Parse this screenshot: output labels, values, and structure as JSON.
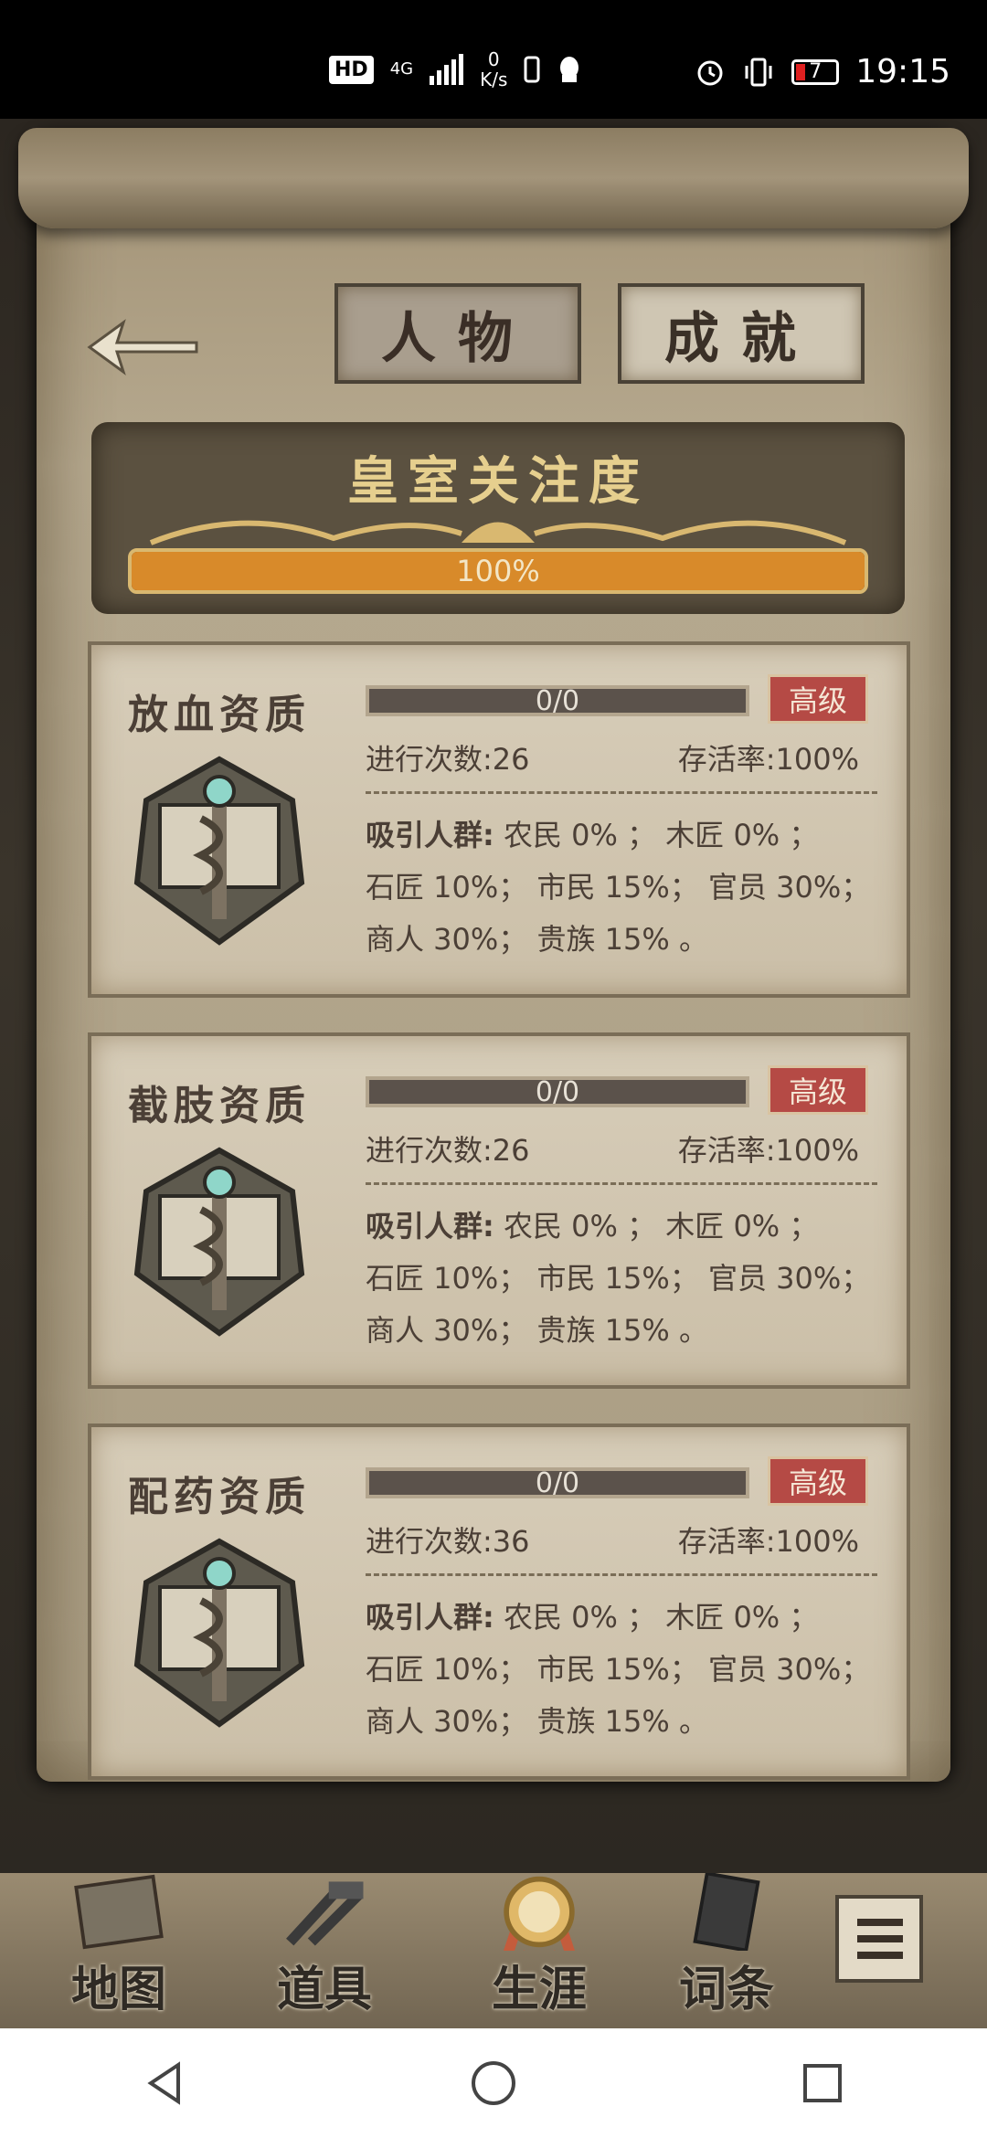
{
  "status_bar": {
    "hd": "HD",
    "net": "4G",
    "speed_value": "0",
    "speed_unit": "K/s",
    "battery": "7",
    "time": "19:15"
  },
  "header": {
    "tabs": [
      {
        "label": "人物",
        "active": true
      },
      {
        "label": "成就",
        "active": false
      }
    ]
  },
  "royal_attention": {
    "title": "皇室关注度",
    "progress_percent": 100,
    "progress_text": "100%"
  },
  "cards": [
    {
      "title": "放血资质",
      "bar_text": "0/0",
      "badge": "高级",
      "count_label": "进行次数:26",
      "survival_label": "存活率:100%",
      "attract_label": "吸引人群:",
      "line1": " 农民 0% ； 木匠 0% ；",
      "line2": "石匠 10%； 市民 15%； 官员 30%；",
      "line3": "商人 30%； 贵族 15% 。"
    },
    {
      "title": "截肢资质",
      "bar_text": "0/0",
      "badge": "高级",
      "count_label": "进行次数:26",
      "survival_label": "存活率:100%",
      "attract_label": "吸引人群:",
      "line1": " 农民 0% ； 木匠 0% ；",
      "line2": "石匠 10%； 市民 15%； 官员 30%；",
      "line3": "商人 30%； 贵族 15% 。"
    },
    {
      "title": "配药资质",
      "bar_text": "0/0",
      "badge": "高级",
      "count_label": "进行次数:36",
      "survival_label": "存活率:100%",
      "attract_label": "吸引人群:",
      "line1": " 农民 0% ； 木匠 0% ；",
      "line2": "石匠 10%； 市民 15%； 官员 30%；",
      "line3": "商人 30%； 贵族 15% 。"
    }
  ],
  "bottom_menu": {
    "map": "地图",
    "items": "道具",
    "career": "生涯",
    "words": "词条"
  },
  "colors": {
    "accent_orange": "#d88a2a",
    "badge_red": "#b54a45",
    "parchment": "#d7cdb9"
  }
}
